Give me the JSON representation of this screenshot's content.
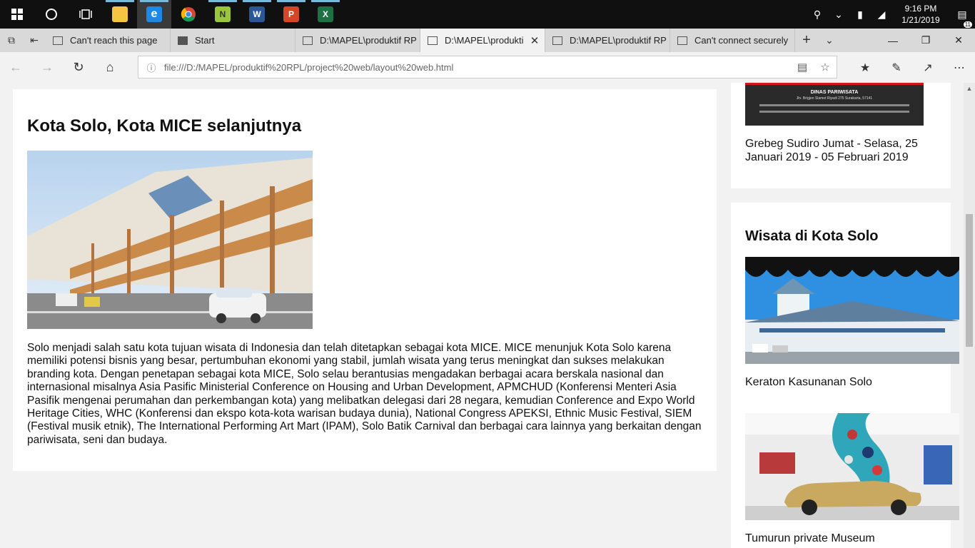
{
  "taskbar": {
    "apps": [
      "File Explorer",
      "Microsoft Edge",
      "Google Chrome",
      "Notepad++",
      "Word",
      "PowerPoint",
      "Excel"
    ],
    "time": "9:16 PM",
    "date": "1/21/2019",
    "notification_count": "11"
  },
  "tabs": [
    {
      "label": "Can't reach this page"
    },
    {
      "label": "Start"
    },
    {
      "label": "D:\\MAPEL\\produktif RP"
    },
    {
      "label": "D:\\MAPEL\\produkti"
    },
    {
      "label": "D:\\MAPEL\\produktif RP"
    },
    {
      "label": "Can't connect securely"
    }
  ],
  "address": {
    "url": "file:///D:/MAPEL/produktif%20RPL/project%20web/layout%20web.html"
  },
  "article": {
    "title": "Kota Solo, Kota MICE selanjutnya",
    "body": "Solo menjadi salah satu kota tujuan wisata di Indonesia dan telah ditetapkan sebagai kota MICE. MICE menunjuk Kota Solo karena memiliki potensi bisnis yang besar, pertumbuhan ekonomi yang stabil, jumlah wisata yang terus meningkat dan sukses melakukan branding kota. Dengan penetapan sebagai kota MICE, Solo selau berantusias mengadakan berbagai acara berskala nasional dan internasional misalnya Asia Pasific Ministerial Conference on Housing and Urban Development, APMCHUD (Konferensi Menteri Asia Pasifik mengenai perumahan dan perkembangan kota) yang melibatkan delegasi dari 28 negara, kemudian Conference and Expo World Heritage Cities, WHC (Konferensi dan ekspo kota-kota warisan budaya dunia), National Congress APEKSI, Ethnic Music Festival, SIEM (Festival musik etnik), The International Performing Art Mart (IPAM), Solo Batik Carnival dan berbagai cara lainnya yang berkaitan dengan pariwisata, seni dan budaya."
  },
  "event": {
    "poster_title": "DINAS PARIWISATA",
    "poster_address": "Jln. Brigjen Slamet Riyadi 275 Surakarta, 57141",
    "caption": "Grebeg Sudiro Jumat - Selasa, 25 Januari 2019 - 05 Februari 2019"
  },
  "wisata": {
    "heading": "Wisata di Kota Solo",
    "items": [
      {
        "caption": "Keraton Kasunanan Solo"
      },
      {
        "caption": "Tumurun private Museum"
      }
    ]
  }
}
